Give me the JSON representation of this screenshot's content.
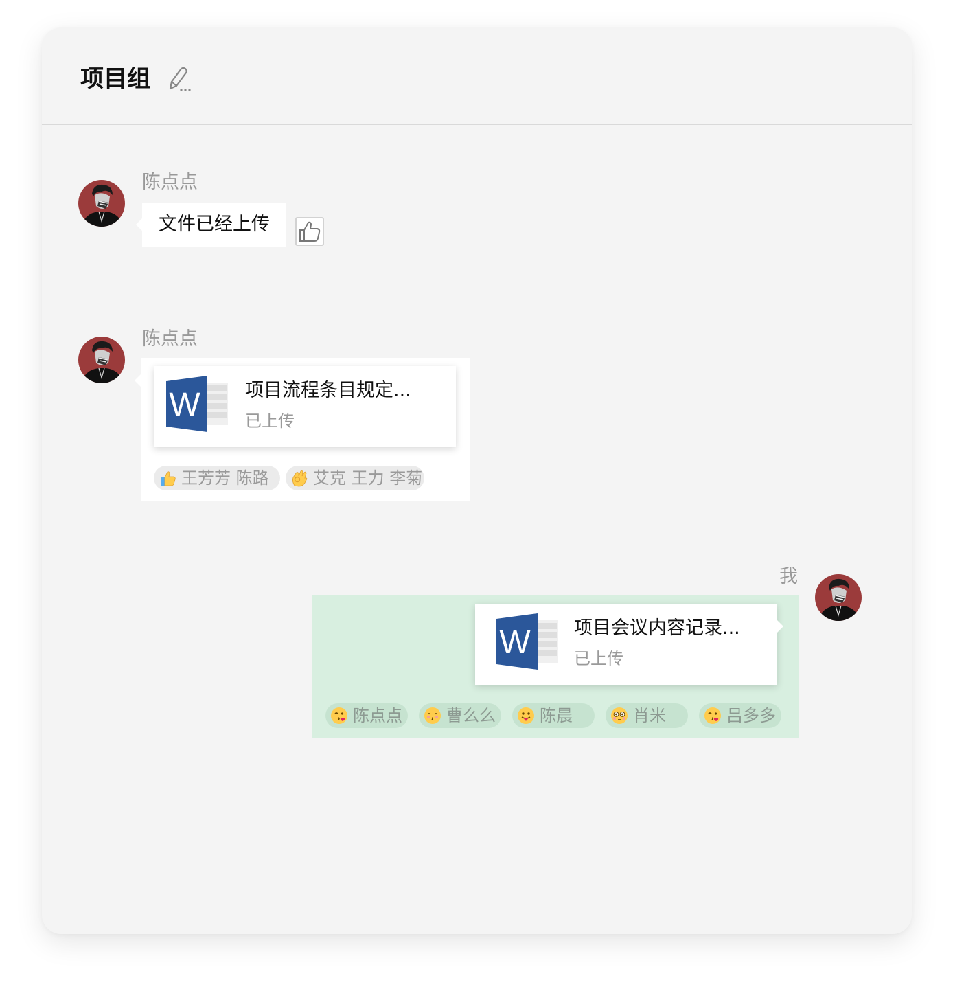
{
  "header": {
    "title": "项目组",
    "edit_icon": "pencil-edit-icon"
  },
  "messages": [
    {
      "sender": "陈点点",
      "text": "文件已经上传",
      "action_icon": "thumbs-up-icon"
    },
    {
      "sender": "陈点点",
      "file": {
        "icon": "word-document-icon",
        "name": "项目流程条目规定...",
        "status": "已上传"
      },
      "reactions": [
        {
          "icon": "thumbs-up-emoji",
          "users": "王芳芳 陈路"
        },
        {
          "icon": "ok-hand-emoji",
          "users": "艾克 王力 李菊"
        }
      ]
    },
    {
      "sender": "我",
      "file": {
        "icon": "word-document-icon",
        "name": "项目会议内容记录...",
        "status": "已上传"
      },
      "reactions": [
        {
          "icon": "kissing-face-emoji",
          "users": "陈点点"
        },
        {
          "icon": "kissing-closed-eyes-emoji",
          "users": "曹么么"
        },
        {
          "icon": "tongue-out-emoji",
          "users": "陈晨"
        },
        {
          "icon": "flushed-face-emoji",
          "users": "肖米"
        },
        {
          "icon": "kissing-face-emoji",
          "users": "吕多多"
        }
      ]
    }
  ],
  "colors": {
    "card_bg": "#f4f4f4",
    "my_bubble_bg": "#d8efe0",
    "word_blue": "#2b579a",
    "avatar_bg": "#9b3b3b"
  }
}
